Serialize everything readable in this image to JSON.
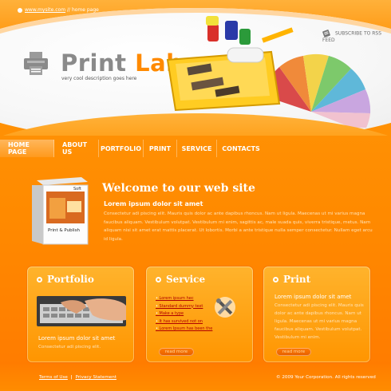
{
  "top_link": {
    "site": "www.mysite.com",
    "separator": "//",
    "label": "home page"
  },
  "rss": {
    "label": "SUBSCRIBE TO RSS FEED",
    "icon": "rss-feed-icon"
  },
  "logo": {
    "word1": "Print",
    "word2": "Lab",
    "tagline": "very cool description goes here",
    "icon": "printer-icon"
  },
  "nav": {
    "items": [
      "HOME PAGE",
      "ABOUT US",
      "PORTFOLIO",
      "PRINT",
      "SERVICE",
      "CONTACTS"
    ]
  },
  "welcome": {
    "title": "Welcome to our web site",
    "subtitle": "Lorem ipsum dolor sit amet",
    "text": "Consectetur adi piscing elit. Mauris quis dolor ac ante dapibus rhoncus. Nam ut ligula. Maecenas ut mi varius magna faucibus aliquam. Vestibulum volutpat. Vestibulum mi enim, sagittis ac, male suada quis, viverra tristique, metus.  Nam aliquam nisi sit amet erat mattis placerat. Ut lobortis. Morbi a ante tristique nulla semper consectetur. Nullam eget arcu id ligula.",
    "box_label": "Print & Publish",
    "box_brand": "Soft"
  },
  "panels": {
    "portfolio": {
      "title": "Portfolio",
      "heading": "Lorem ipsum dolor sit amet",
      "text": "Consectetur adi piscing elit."
    },
    "service": {
      "title": "Service",
      "links": [
        "Lorem ipsum hec",
        "Standard dummy text",
        "Make a type",
        "It has survived not on",
        "Lorem Ipsum has been the"
      ],
      "readmore": "read more"
    },
    "print": {
      "title": "Print",
      "heading": "Lorem ipsum dolor sit amet",
      "text": "Consectetur adi piscing elit. Mauris quis dolor ac ante dapibus rhoncus. Nam ut ligula. Maecenas ut mi varius magna faucibus aliquam. Vestibulum volutpat. Vestibulum mi enim.",
      "readmore": "read more"
    }
  },
  "footer": {
    "terms": "Terms of Use",
    "sep": "|",
    "privacy": "Privacy Statement",
    "copyright": "© 2009 Your Corporation. All rights reserved"
  },
  "colors": {
    "accent": "#ff8a00",
    "logo_grey": "#8a8a8a",
    "link_red": "#b00000"
  }
}
